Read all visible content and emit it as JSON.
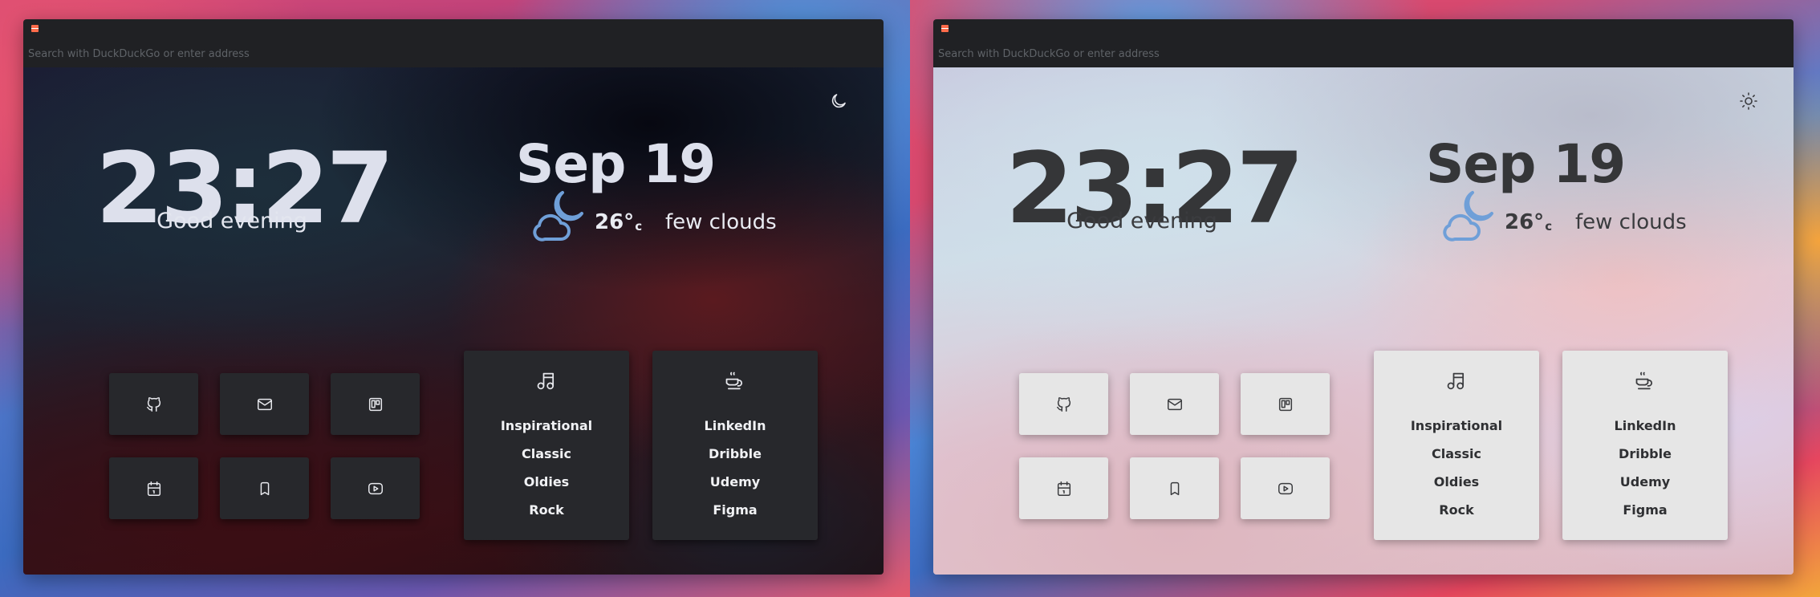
{
  "browser": {
    "address_placeholder": "Search with DuckDuckGo or enter address"
  },
  "time": "23:27",
  "greeting": "Good evening",
  "date": "Sep 19",
  "weather": {
    "temperature": "26°",
    "unit": "c",
    "description": "few clouds",
    "icon": "moon-cloud-icon",
    "icon_color": "#6f9fd8"
  },
  "shortcuts": [
    {
      "icon": "github-icon"
    },
    {
      "icon": "mail-icon"
    },
    {
      "icon": "trello-icon"
    },
    {
      "icon": "calendar-icon"
    },
    {
      "icon": "bookmark-icon"
    },
    {
      "icon": "youtube-icon"
    }
  ],
  "cards": [
    {
      "icon": "music-note-icon",
      "links": [
        "Inspirational",
        "Classic",
        "Oldies",
        "Rock"
      ]
    },
    {
      "icon": "coffee-cup-icon",
      "links": [
        "LinkedIn",
        "Dribble",
        "Udemy",
        "Figma"
      ]
    }
  ],
  "themes": {
    "dark": {
      "toggle_icon": "moon-icon"
    },
    "light": {
      "toggle_icon": "sun-icon"
    }
  }
}
